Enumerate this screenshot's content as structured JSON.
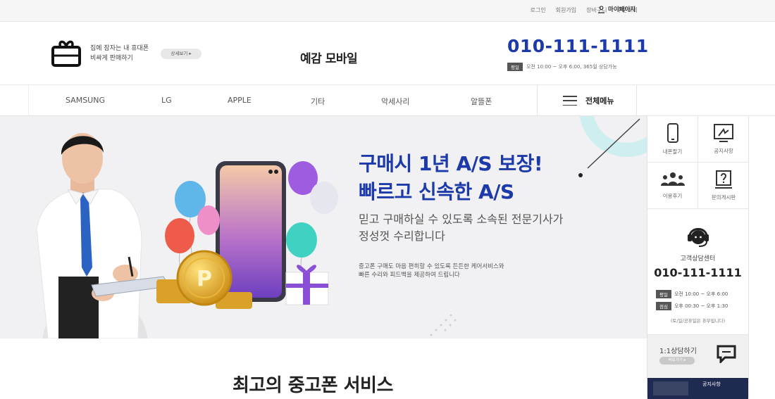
{
  "topbar": {
    "links": [
      "로그인",
      "회원가입",
      "장바구니",
      "주문조회"
    ],
    "mypage": "마이페이지"
  },
  "header": {
    "promo_line1": "집에 잠자는 내 휴대폰",
    "promo_line2": "비싸게 판매하기",
    "detail_button": "상세보기 ▸",
    "logo": "예감 모바일",
    "phone": "010-111-1111",
    "hours_tag": "평일",
    "hours_text": "오전 10:00 ~ 오후 6:00, 365일 상담가능"
  },
  "nav": {
    "items": [
      "SAMSUNG",
      "LG",
      "APPLE",
      "기타",
      "악세사리",
      "알뜰폰"
    ],
    "all_menu": "전체메뉴"
  },
  "hero": {
    "title_line1": "구매시 1년 A/S 보장!",
    "title_line2": "빠르고 신속한 A/S",
    "sub_line1": "믿고 구매하실 수 있도록 소속된 전문기사가",
    "sub_line2": "정성껏 수리합니다",
    "small_line1": "중고폰 구매도 마음 편히할 수 있도록 든든한 케어서비스와",
    "small_line2": "빠른 수리와 피드백을 제공하여 드립니다",
    "coin_letter": "P"
  },
  "quick_menu": {
    "cells": [
      "내폰팔기",
      "공지사항",
      "이용후기",
      "문의게시판"
    ],
    "cs_title": "고객상담센터",
    "cs_phone": "010-111-1111",
    "weekday_tag": "평일",
    "weekday_hours": "오전 10:00 ~ 오후 6:00",
    "lunch_tag": "점심",
    "lunch_hours": "오후 00:30 ~ 오후 1:30",
    "note": "(토/일/공휴일은 휴무입니다)",
    "consult_title": "1:1상담하기",
    "consult_button": "바로가기 ▸",
    "strip_text": "공지사항"
  },
  "section": {
    "title": "최고의 중고폰 서비스"
  },
  "colors": {
    "accent": "#1c3aa9",
    "hero_bg": "#f1f1f3",
    "teal_deco": "#cfeef0"
  }
}
